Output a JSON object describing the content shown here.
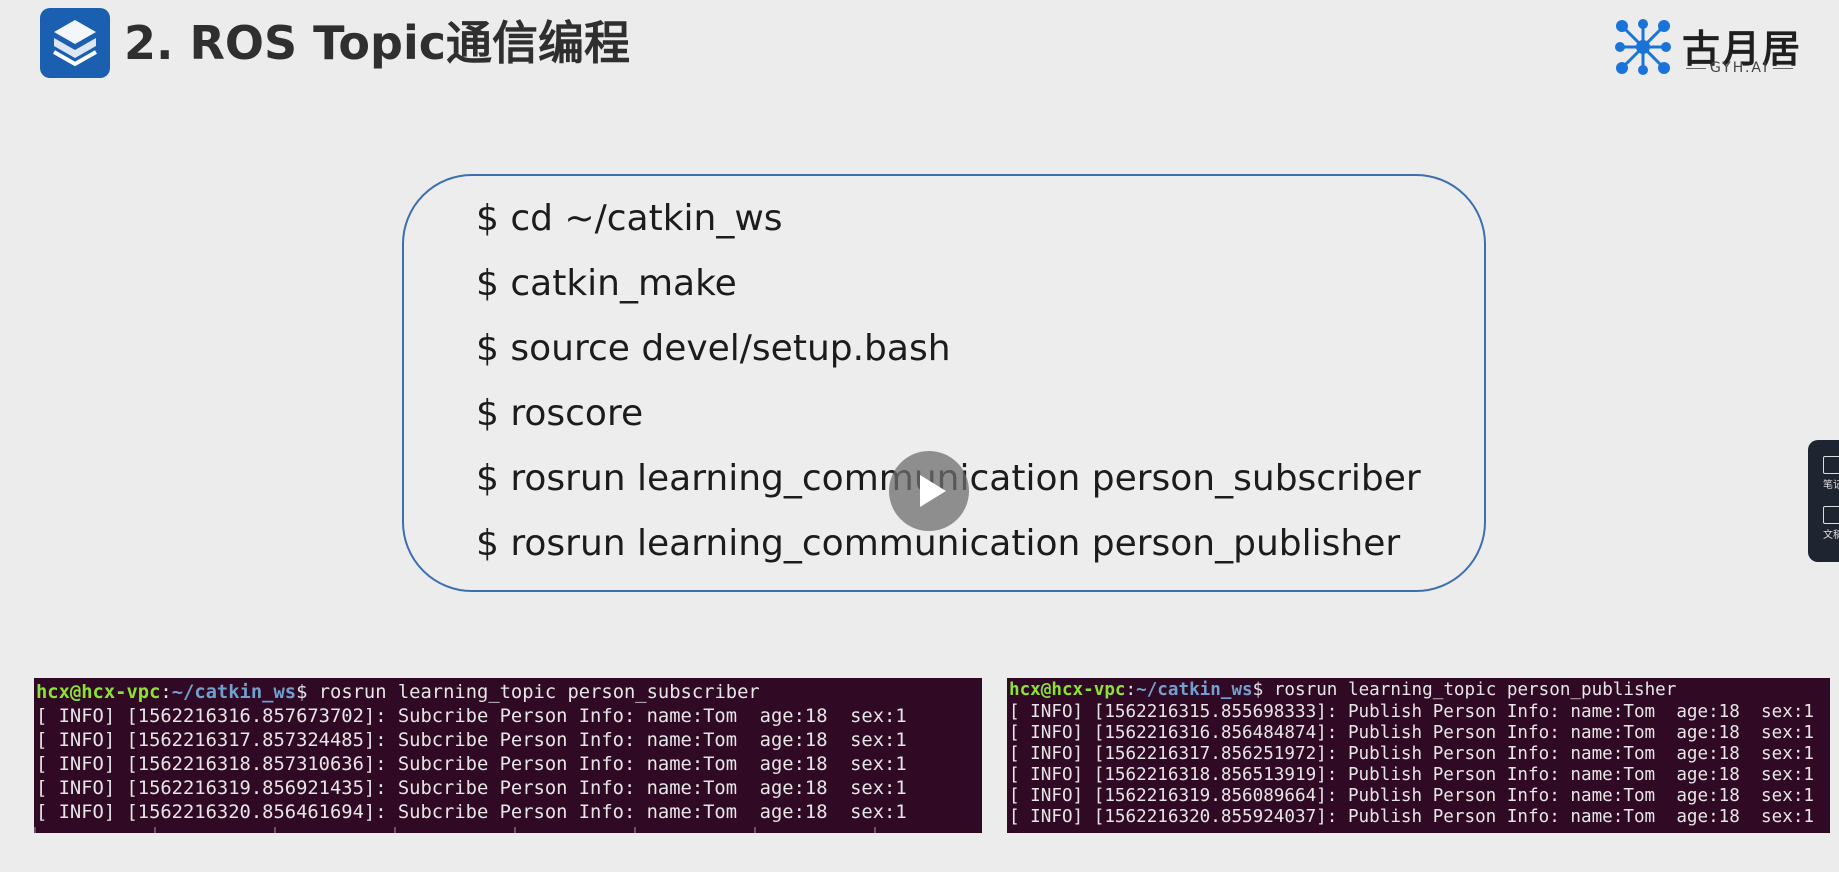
{
  "slide": {
    "title": "2. ROS Topic通信编程",
    "brand_name": "古月居",
    "brand_sub": "GYH.AI"
  },
  "commands": [
    "$ cd ~/catkin_ws",
    "$ catkin_make",
    "$ source devel/setup.bash",
    "$ roscore",
    "$ rosrun learning_communication person_subscriber",
    "$ rosrun learning_communication person_publisher"
  ],
  "terminal_left": {
    "prompt_user": "hcx@hcx-vpc",
    "prompt_path": "~/catkin_ws",
    "command": "$ rosrun learning_topic person_subscriber",
    "lines": [
      "[ INFO] [1562216316.857673702]: Subcribe Person Info: name:Tom  age:18  sex:1",
      "[ INFO] [1562216317.857324485]: Subcribe Person Info: name:Tom  age:18  sex:1",
      "[ INFO] [1562216318.857310636]: Subcribe Person Info: name:Tom  age:18  sex:1",
      "[ INFO] [1562216319.856921435]: Subcribe Person Info: name:Tom  age:18  sex:1",
      "[ INFO] [1562216320.856461694]: Subcribe Person Info: name:Tom  age:18  sex:1"
    ]
  },
  "terminal_right": {
    "prompt_user": "hcx@hcx-vpc",
    "prompt_path": "~/catkin_ws",
    "command": "$ rosrun learning_topic person_publisher",
    "lines": [
      "[ INFO] [1562216315.855698333]: Publish Person Info: name:Tom  age:18  sex:1",
      "[ INFO] [1562216316.856484874]: Publish Person Info: name:Tom  age:18  sex:1",
      "[ INFO] [1562216317.856251972]: Publish Person Info: name:Tom  age:18  sex:1",
      "[ INFO] [1562216318.856513919]: Publish Person Info: name:Tom  age:18  sex:1",
      "[ INFO] [1562216319.856089664]: Publish Person Info: name:Tom  age:18  sex:1",
      "[ INFO] [1562216320.855924037]: Publish Person Info: name:Tom  age:18  sex:1"
    ]
  },
  "side_panel": {
    "items": [
      "笔记",
      "文稿"
    ]
  },
  "icons": {
    "course_logo": "s-cube-logo-icon",
    "brand_logo": "molecule-logo-icon",
    "play": "play-icon",
    "note": "note-icon",
    "doc": "document-icon"
  },
  "colors": {
    "logo_blue": "#1a5fb0",
    "box_border": "#3b6fb0",
    "terminal_bg": "#300a24",
    "prompt_green": "#8ae234",
    "prompt_blue": "#729fcf"
  }
}
